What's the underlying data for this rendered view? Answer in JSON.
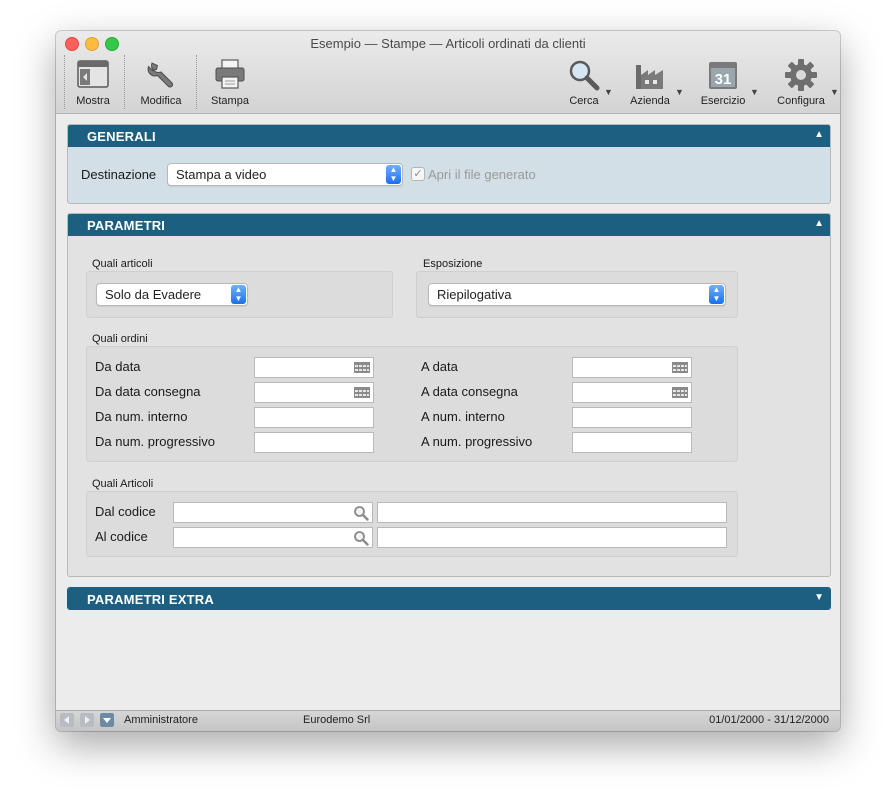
{
  "window": {
    "title": "Esempio — Stampe — Articoli ordinati da clienti"
  },
  "toolbar": {
    "mostra": "Mostra",
    "modifica": "Modifica",
    "stampa": "Stampa",
    "cerca": "Cerca",
    "azienda": "Azienda",
    "esercizio": "Esercizio",
    "esercizio_day": "31",
    "configura": "Configura"
  },
  "generali": {
    "title": "GENERALI",
    "destinazione_label": "Destinazione",
    "destinazione_value": "Stampa a video",
    "apri_file_label": "Apri il file generato"
  },
  "parametri": {
    "title": "PARAMETRI",
    "quali_articoli_label": "Quali articoli",
    "quali_articoli_value": "Solo da Evadere",
    "esposizione_label": "Esposizione",
    "esposizione_value": "Riepilogativa",
    "quali_ordini_label": "Quali ordini",
    "da_data": "Da data",
    "a_data": "A data",
    "da_data_consegna": "Da data consegna",
    "a_data_consegna": "A data consegna",
    "da_num_interno": "Da num. interno",
    "a_num_interno": "A num. interno",
    "da_num_progressivo": "Da num. progressivo",
    "a_num_progressivo": "A num. progressivo",
    "quali_articoli2_label": "Quali Articoli",
    "dal_codice": "Dal codice",
    "al_codice": "Al codice"
  },
  "parametri_extra": {
    "title": "PARAMETRI EXTRA"
  },
  "statusbar": {
    "user": "Amministratore",
    "company": "Eurodemo Srl",
    "period": "01/01/2000 - 31/12/2000"
  },
  "colors": {
    "section_header": "#1d5f80",
    "stepper": "#1a6ff1"
  }
}
